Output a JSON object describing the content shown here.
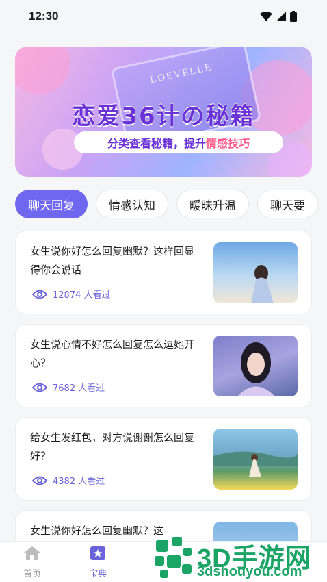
{
  "status": {
    "time": "12:30"
  },
  "banner": {
    "title": "恋爱36计の秘籍",
    "subtitle_prefix": "分类查看秘籍，提升",
    "subtitle_highlight": "情感技巧",
    "book_text": "LOEVELLE"
  },
  "tabs": [
    {
      "label": "聊天回复",
      "active": true
    },
    {
      "label": "情感认知",
      "active": false
    },
    {
      "label": "暧昧升温",
      "active": false
    },
    {
      "label": "聊天要",
      "active": false
    }
  ],
  "articles": [
    {
      "title": "女生说你好怎么回复幽默？这样回显得你会说话",
      "views": "12874 人看过",
      "thumb_color": "#7fb8e8"
    },
    {
      "title": "女生说心情不好怎么回复怎么逗她开心？",
      "views": "7682 人看过",
      "thumb_color": "#8a8fc4"
    },
    {
      "title": "给女生发红包，对方说谢谢怎么回复好？",
      "views": "4382 人看过",
      "thumb_color": "#5ea8b5"
    },
    {
      "title": "女生说你好怎么回复幽默？这",
      "views": "",
      "thumb_color": "#9cc7ea"
    }
  ],
  "nav": [
    {
      "label": "首页",
      "icon": "home-icon",
      "active": false
    },
    {
      "label": "宝典",
      "icon": "book-star-icon",
      "active": true
    }
  ],
  "watermark": {
    "text": "3D手游网",
    "url": "3dshouyou.com"
  },
  "colors": {
    "accent": "#7067f0",
    "view_text": "#6b63d9",
    "watermark": "#1aa566"
  }
}
